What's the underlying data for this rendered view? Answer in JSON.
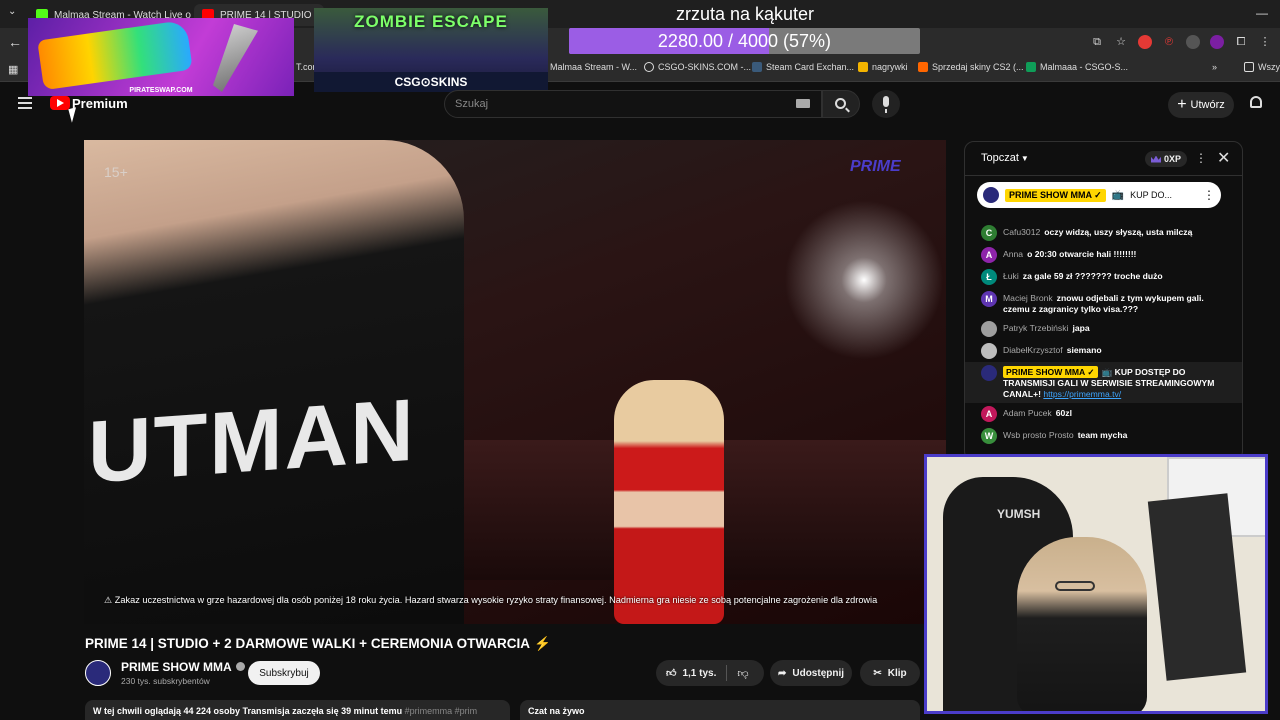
{
  "browser": {
    "tabs": [
      {
        "title": "Malmaa Stream - Watch Live o",
        "favicon_color": "#53fc18",
        "active": false
      },
      {
        "title": "PRIME 14 | STUDIO + 2 DA",
        "favicon_color": "#ff0000",
        "active": true
      }
    ],
    "bookmarks": [
      {
        "label": "T.com",
        "icon_color": "#888888"
      },
      {
        "label": "Malmaa Stream - W...",
        "icon_color": "#ffffff"
      },
      {
        "label": "CSGO-SKINS.COM -...",
        "icon_color": "#ffffff"
      },
      {
        "label": "Steam Card Exchan...",
        "icon_color": "#1b2838"
      },
      {
        "label": "nagrywki",
        "icon_color": "#f4b400"
      },
      {
        "label": "Sprzedaj skiny CS2 (...",
        "icon_color": "#ff6600"
      },
      {
        "label": "Malmaaa - CSGO-S...",
        "icon_color": "#0f9d58"
      },
      {
        "label": "Wszy",
        "icon_color": "#dddddd"
      }
    ]
  },
  "overlays": {
    "pirate_label": "PIRATESWAP.COM",
    "zombie_title": "ZOMBIE ESCAPE",
    "csg_label": "CSG⊙SKINS",
    "goal_title": "zrzuta na kąkuter",
    "goal_text": "2280.00 / 4000 (57%)",
    "goal_fraction": 0.57
  },
  "youtube": {
    "logo_label": "Premium",
    "search_placeholder": "Szukaj",
    "create_label": "Utwórz"
  },
  "video": {
    "overlay_text": "UTMAN",
    "prime_logo": "PRIME",
    "age": "15+",
    "warning": "⚠ Zakaz uczestnictwa w grze hazardowej dla osób poniżej 18 roku życia. Hazard stwarza wysokie ryzyko straty finansowej. Nadmierna gra niesie ze sobą potencjalne zagrożenie dla zdrowia"
  },
  "info": {
    "title": "PRIME 14 | STUDIO + 2 DARMOWE WALKI + CEREMONIA OTWARCIA",
    "title_emoji": "⚡",
    "channel_name": "PRIME SHOW MMA",
    "subscribers": "230 tys. subskrybentów",
    "subscribe_label": "Subskrybuj",
    "likes": "1,1 tys.",
    "share_label": "Udostępnij",
    "clip_label": "Klip",
    "desc_watching": "W tej chwili oglądają 44 224 osoby  Transmisja zaczęła się 39 minut temu ",
    "desc_tags": "#primemma #prim",
    "live_chat_label": "Czat na żywo"
  },
  "chat": {
    "title": "Topczat",
    "xp": "0XP",
    "pinned": {
      "badge": "PRIME SHOW MMA ✓",
      "text": "KUP DO..."
    },
    "messages": [
      {
        "author": "Cafu3012",
        "text": "oczy widzą, uszy słyszą, usta milczą",
        "initial": "C",
        "color": "#2e7d32"
      },
      {
        "author": "Anna",
        "text": "o 20:30 otwarcie hali !!!!!!!!",
        "initial": "A",
        "color": "#8e24aa"
      },
      {
        "author": "Łuki",
        "text": "za gale 59 zł ??????? troche dużo",
        "initial": "Ł",
        "color": "#00897b"
      },
      {
        "author": "Maciej Bronk",
        "text": "znowu odjebali z tym wykupem gali. czemu z zagranicy tylko visa.???",
        "initial": "M",
        "color": "#5e35b1"
      },
      {
        "author": "Patryk Trzebiński",
        "text": "japa",
        "initial": "",
        "color": "#9e9e9e"
      },
      {
        "author": "DiabełKrzysztof",
        "text": "siemano",
        "initial": "",
        "color": "#bdbdbd"
      },
      {
        "author": "PRIME SHOW MMA ✓",
        "text": "📺 KUP DOSTĘP DO TRANSMISJI GALI W SERWISIE STREAMINGOWYM CANAL+! ",
        "link": "https://primemma.tv/",
        "initial": "",
        "color": "#2a2a7a",
        "highlight": true
      },
      {
        "author": "Adam Pucek",
        "text": "60zl",
        "initial": "A",
        "color": "#c2185b"
      },
      {
        "author": "Wsb prosto Prosto",
        "text": "team mycha",
        "initial": "W",
        "color": "#388e3c"
      }
    ]
  },
  "webcam": {
    "chair_logo": "YUMSH"
  }
}
